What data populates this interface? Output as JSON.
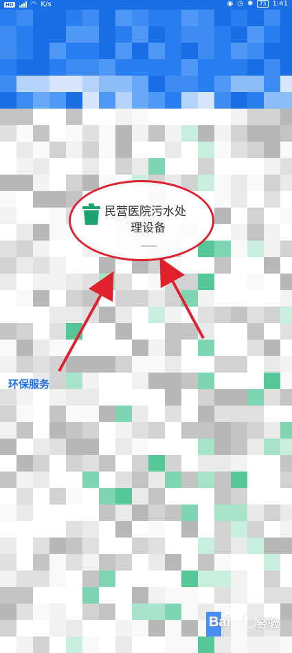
{
  "status_bar": {
    "hd_label": "HD",
    "network_speed": "K/s",
    "battery": "73",
    "time": "1:41"
  },
  "popup": {
    "title_line1": "民营医院污水处",
    "title_line2": "理设备",
    "icon": "trash-bin-icon",
    "icon_color": "#1aa36c",
    "border_color": "#e0202c"
  },
  "sidebar": {
    "active_category": "环保服务",
    "active_color": "#1a6fe6"
  },
  "watermark": {
    "latin": "Bai",
    "chinese": "经验"
  }
}
